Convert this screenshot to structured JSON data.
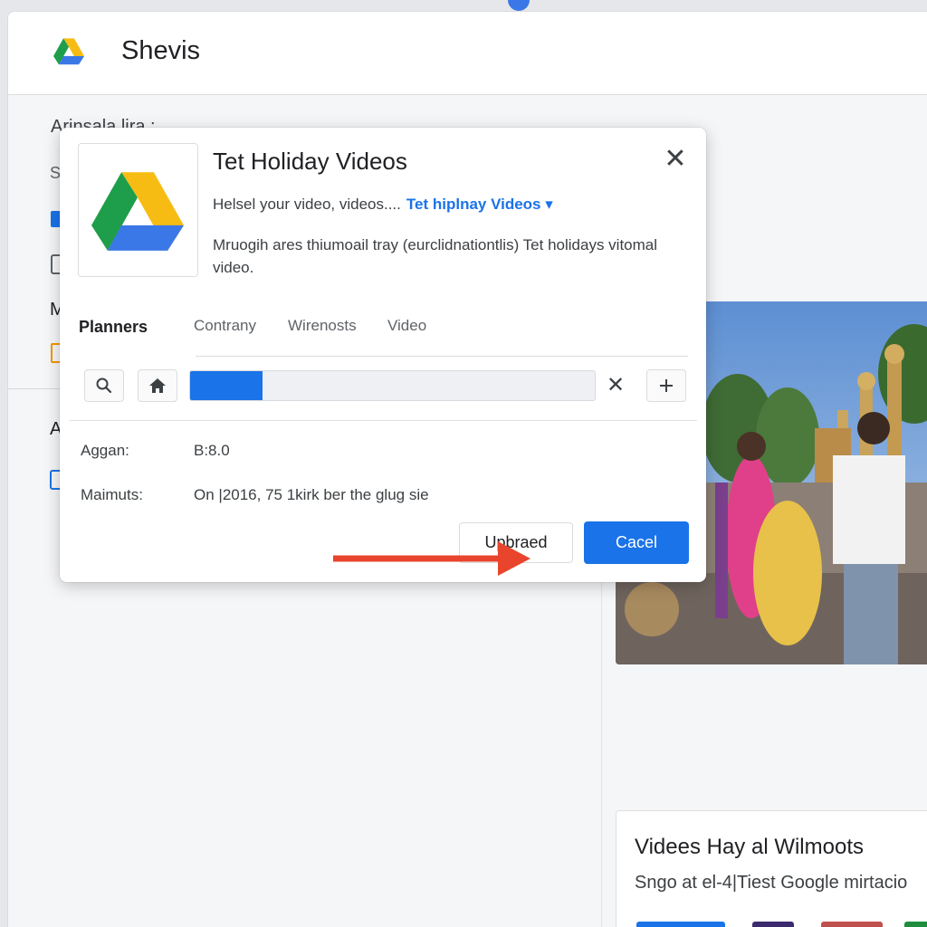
{
  "app": {
    "title": "Shevis",
    "logo_icon": "google-drive-icon"
  },
  "sidebar": {
    "heading": "Arinsala lira :",
    "fragments": [
      "S",
      "M",
      "A"
    ]
  },
  "dialog": {
    "title": "Tet Holiday Videos",
    "line1_prefix": "Helsel your video, videos....",
    "line1_link": "Tet hiplnay Videos",
    "line1_caret": "▾",
    "description": "Mruogih ares thiumoail tray (eurclidnationtlis) Tet holidays vitomal video.",
    "close_symbol": "✕",
    "tabs_label": "Planners",
    "tabs": [
      "Contrany",
      "Wirenosts",
      "Video"
    ],
    "progress": {
      "fraction": 0.18,
      "color": "#1a73e8"
    },
    "toolbar_icons": [
      "search-icon",
      "home-icon",
      "clear-icon",
      "plus-icon"
    ],
    "clear_symbol": "✕",
    "fields": [
      {
        "label": "Aggan:",
        "value": "B:8.0"
      },
      {
        "label": "Maimuts:",
        "value": "On |2016, 75 1kirk ber the glug sie"
      }
    ],
    "buttons": {
      "secondary": "Upbraed",
      "primary": "Cacel"
    }
  },
  "bottom_card": {
    "title": "Videes Hay al Wilmoots",
    "subtitle": "Sngo at el-4|Tiest Google mirtacio"
  },
  "colors": {
    "accent": "#1a73e8",
    "arrow": "#e8452c",
    "drive_green": "#1e9e4a",
    "drive_yellow": "#f7bc14",
    "drive_blue": "#3b78e7"
  }
}
